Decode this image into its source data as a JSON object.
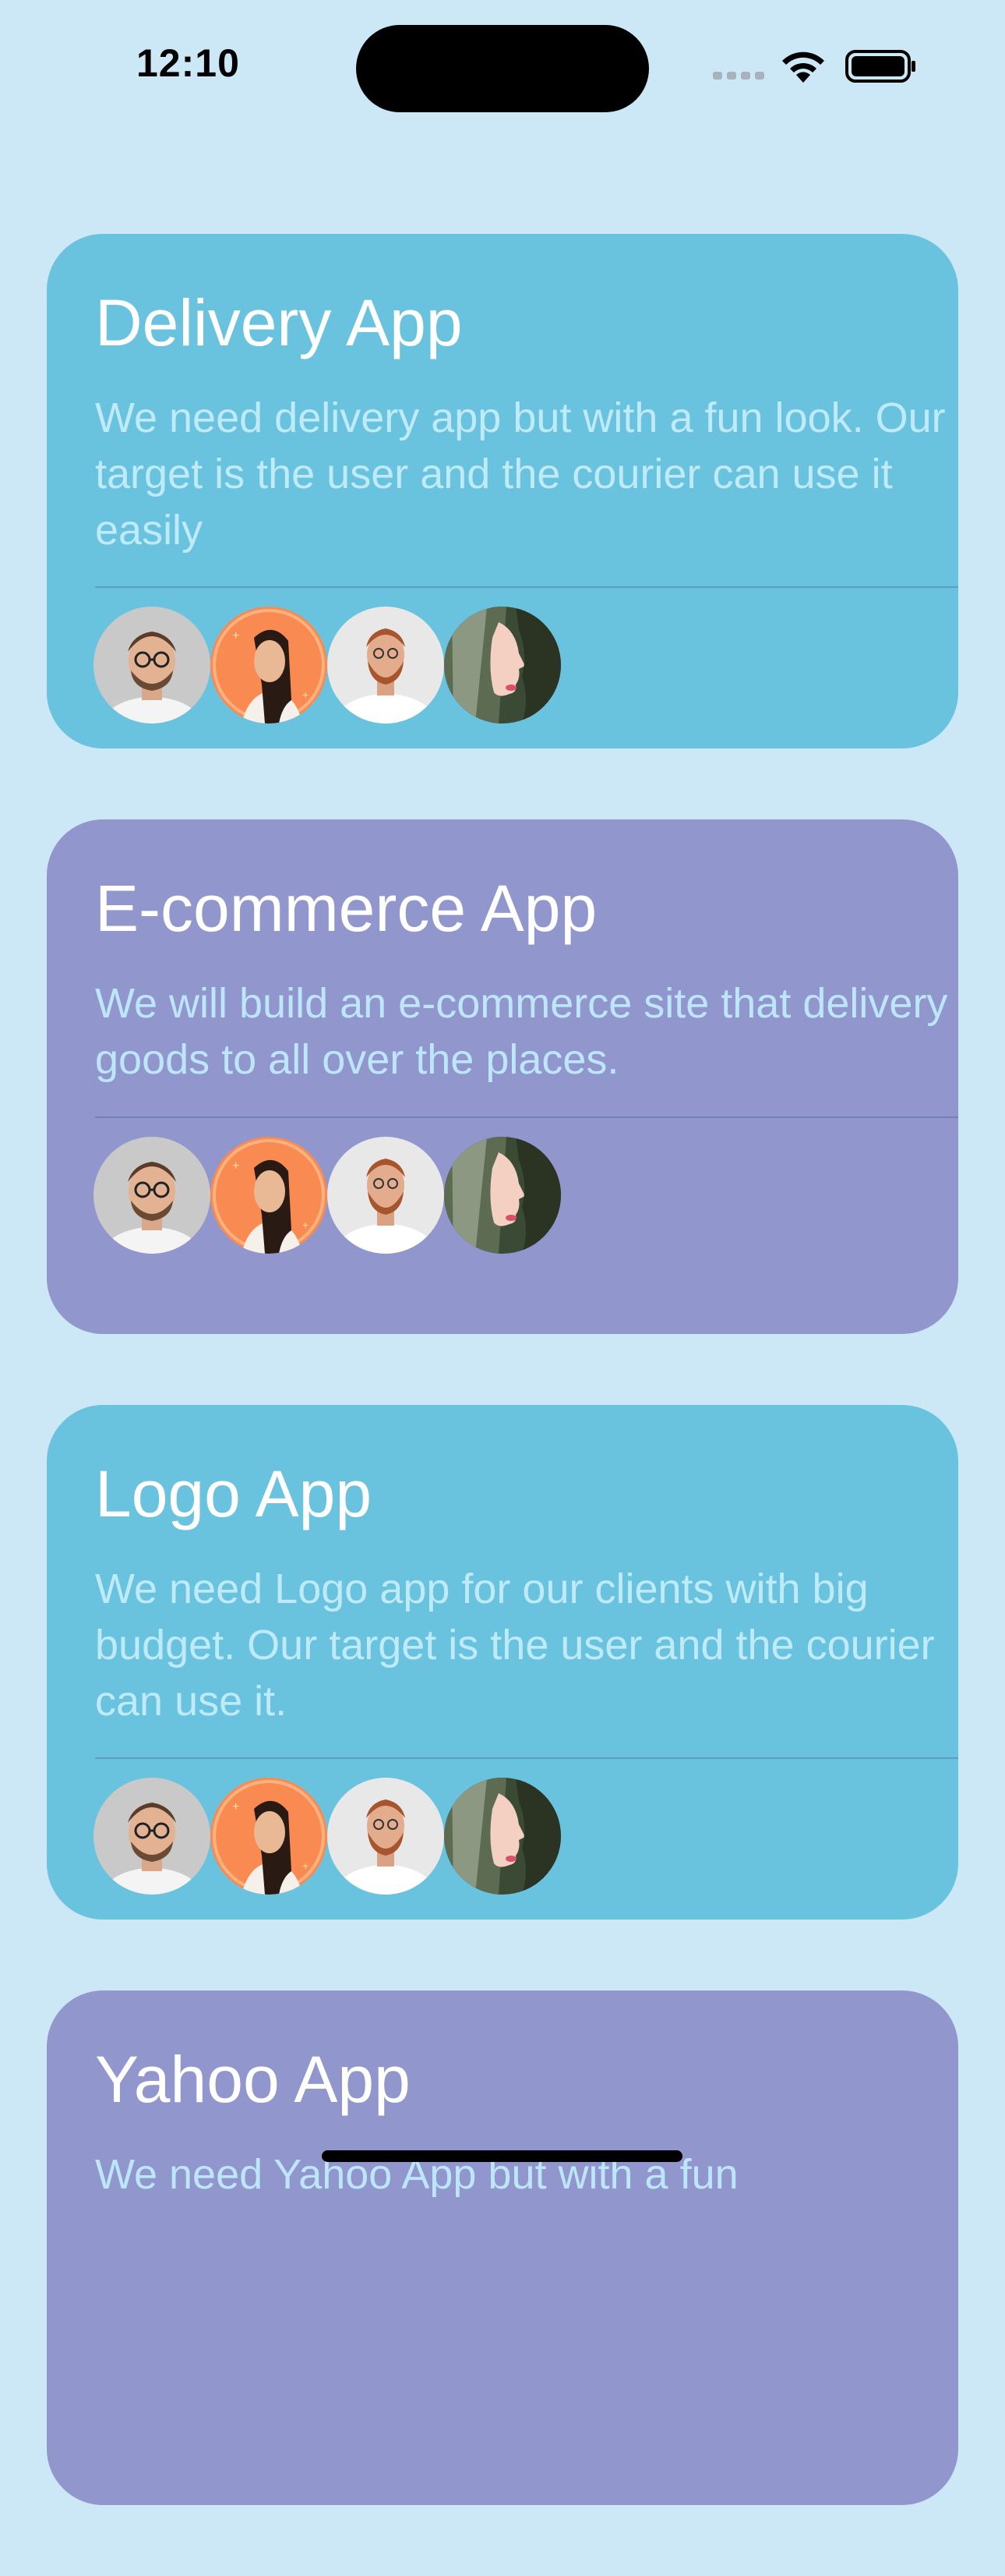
{
  "status_bar": {
    "time": "12:10"
  },
  "cards": [
    {
      "title": "Delivery App",
      "description": "We need delivery app but with a fun look. Our target is the user and the courier can use it easily",
      "color": "#69c3df",
      "members": [
        "man-glasses-avatar",
        "woman-orange-avatar",
        "man-beard-avatar",
        "woman-profile-avatar"
      ]
    },
    {
      "title": "E-commerce App",
      "description": "We will build an e-commerce site that delivery goods to all over the places.",
      "color": "#9196cd",
      "members": [
        "man-glasses-avatar",
        "woman-orange-avatar",
        "man-beard-avatar",
        "woman-profile-avatar"
      ]
    },
    {
      "title": "Logo App",
      "description": "We need Logo app for our clients with big budget. Our target is the user and the courier can use it.",
      "color": "#69c3df",
      "members": [
        "man-glasses-avatar",
        "woman-orange-avatar",
        "man-beard-avatar",
        "woman-profile-avatar"
      ]
    },
    {
      "title": "Yahoo App",
      "description": "We need Yahoo App but with a fun",
      "color": "#9196cd",
      "members": []
    }
  ]
}
